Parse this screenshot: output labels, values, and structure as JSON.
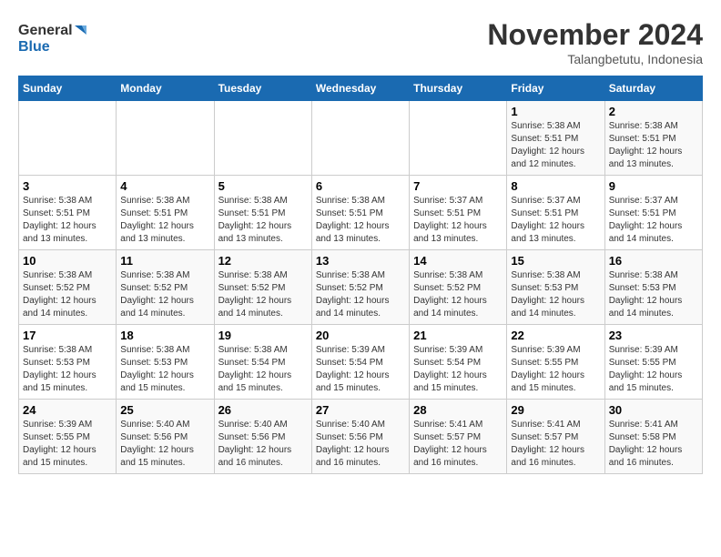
{
  "logo": {
    "line1": "General",
    "line2": "Blue"
  },
  "title": "November 2024",
  "location": "Talangbetutu, Indonesia",
  "weekdays": [
    "Sunday",
    "Monday",
    "Tuesday",
    "Wednesday",
    "Thursday",
    "Friday",
    "Saturday"
  ],
  "weeks": [
    [
      {
        "day": "",
        "info": ""
      },
      {
        "day": "",
        "info": ""
      },
      {
        "day": "",
        "info": ""
      },
      {
        "day": "",
        "info": ""
      },
      {
        "day": "",
        "info": ""
      },
      {
        "day": "1",
        "info": "Sunrise: 5:38 AM\nSunset: 5:51 PM\nDaylight: 12 hours\nand 12 minutes."
      },
      {
        "day": "2",
        "info": "Sunrise: 5:38 AM\nSunset: 5:51 PM\nDaylight: 12 hours\nand 13 minutes."
      }
    ],
    [
      {
        "day": "3",
        "info": "Sunrise: 5:38 AM\nSunset: 5:51 PM\nDaylight: 12 hours\nand 13 minutes."
      },
      {
        "day": "4",
        "info": "Sunrise: 5:38 AM\nSunset: 5:51 PM\nDaylight: 12 hours\nand 13 minutes."
      },
      {
        "day": "5",
        "info": "Sunrise: 5:38 AM\nSunset: 5:51 PM\nDaylight: 12 hours\nand 13 minutes."
      },
      {
        "day": "6",
        "info": "Sunrise: 5:38 AM\nSunset: 5:51 PM\nDaylight: 12 hours\nand 13 minutes."
      },
      {
        "day": "7",
        "info": "Sunrise: 5:37 AM\nSunset: 5:51 PM\nDaylight: 12 hours\nand 13 minutes."
      },
      {
        "day": "8",
        "info": "Sunrise: 5:37 AM\nSunset: 5:51 PM\nDaylight: 12 hours\nand 13 minutes."
      },
      {
        "day": "9",
        "info": "Sunrise: 5:37 AM\nSunset: 5:51 PM\nDaylight: 12 hours\nand 14 minutes."
      }
    ],
    [
      {
        "day": "10",
        "info": "Sunrise: 5:38 AM\nSunset: 5:52 PM\nDaylight: 12 hours\nand 14 minutes."
      },
      {
        "day": "11",
        "info": "Sunrise: 5:38 AM\nSunset: 5:52 PM\nDaylight: 12 hours\nand 14 minutes."
      },
      {
        "day": "12",
        "info": "Sunrise: 5:38 AM\nSunset: 5:52 PM\nDaylight: 12 hours\nand 14 minutes."
      },
      {
        "day": "13",
        "info": "Sunrise: 5:38 AM\nSunset: 5:52 PM\nDaylight: 12 hours\nand 14 minutes."
      },
      {
        "day": "14",
        "info": "Sunrise: 5:38 AM\nSunset: 5:52 PM\nDaylight: 12 hours\nand 14 minutes."
      },
      {
        "day": "15",
        "info": "Sunrise: 5:38 AM\nSunset: 5:53 PM\nDaylight: 12 hours\nand 14 minutes."
      },
      {
        "day": "16",
        "info": "Sunrise: 5:38 AM\nSunset: 5:53 PM\nDaylight: 12 hours\nand 14 minutes."
      }
    ],
    [
      {
        "day": "17",
        "info": "Sunrise: 5:38 AM\nSunset: 5:53 PM\nDaylight: 12 hours\nand 15 minutes."
      },
      {
        "day": "18",
        "info": "Sunrise: 5:38 AM\nSunset: 5:53 PM\nDaylight: 12 hours\nand 15 minutes."
      },
      {
        "day": "19",
        "info": "Sunrise: 5:38 AM\nSunset: 5:54 PM\nDaylight: 12 hours\nand 15 minutes."
      },
      {
        "day": "20",
        "info": "Sunrise: 5:39 AM\nSunset: 5:54 PM\nDaylight: 12 hours\nand 15 minutes."
      },
      {
        "day": "21",
        "info": "Sunrise: 5:39 AM\nSunset: 5:54 PM\nDaylight: 12 hours\nand 15 minutes."
      },
      {
        "day": "22",
        "info": "Sunrise: 5:39 AM\nSunset: 5:55 PM\nDaylight: 12 hours\nand 15 minutes."
      },
      {
        "day": "23",
        "info": "Sunrise: 5:39 AM\nSunset: 5:55 PM\nDaylight: 12 hours\nand 15 minutes."
      }
    ],
    [
      {
        "day": "24",
        "info": "Sunrise: 5:39 AM\nSunset: 5:55 PM\nDaylight: 12 hours\nand 15 minutes."
      },
      {
        "day": "25",
        "info": "Sunrise: 5:40 AM\nSunset: 5:56 PM\nDaylight: 12 hours\nand 15 minutes."
      },
      {
        "day": "26",
        "info": "Sunrise: 5:40 AM\nSunset: 5:56 PM\nDaylight: 12 hours\nand 16 minutes."
      },
      {
        "day": "27",
        "info": "Sunrise: 5:40 AM\nSunset: 5:56 PM\nDaylight: 12 hours\nand 16 minutes."
      },
      {
        "day": "28",
        "info": "Sunrise: 5:41 AM\nSunset: 5:57 PM\nDaylight: 12 hours\nand 16 minutes."
      },
      {
        "day": "29",
        "info": "Sunrise: 5:41 AM\nSunset: 5:57 PM\nDaylight: 12 hours\nand 16 minutes."
      },
      {
        "day": "30",
        "info": "Sunrise: 5:41 AM\nSunset: 5:58 PM\nDaylight: 12 hours\nand 16 minutes."
      }
    ]
  ]
}
